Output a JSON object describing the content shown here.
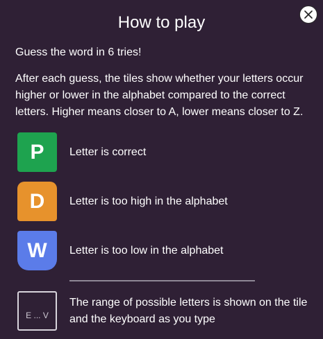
{
  "modal": {
    "title": "How to play",
    "close_label": "Close",
    "intro": "Guess the word in 6 tries!",
    "explanation": "After each guess, the tiles show whether your letters occur higher or lower in the alphabet compared to the correct letters. Higher means closer to A, lower means closer to Z."
  },
  "examples": [
    {
      "letter": "P",
      "label": "Letter is correct",
      "color": "#1ea34f"
    },
    {
      "letter": "D",
      "label": "Letter is too high in the alphabet",
      "color": "#e7922c"
    },
    {
      "letter": "W",
      "label": "Letter is too low in the alphabet",
      "color": "#5b7ce9"
    }
  ],
  "range": {
    "tile_text": "E ... V",
    "description": "The range of possible letters is shown on the tile and the keyboard as you type"
  },
  "colors": {
    "background": "#2f2035",
    "text": "#ffffff",
    "divider": "#8f8896"
  },
  "icons": {
    "close": "close-icon"
  }
}
